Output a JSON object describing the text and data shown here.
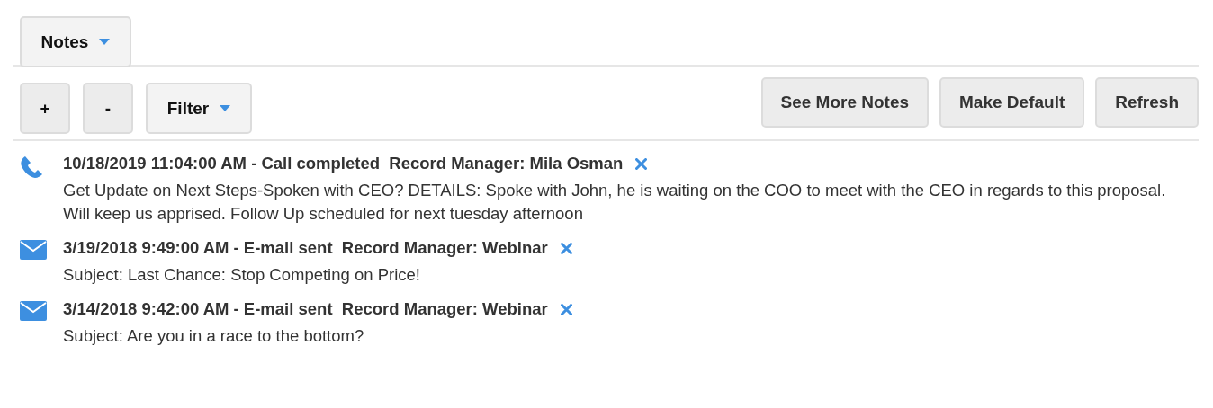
{
  "view_menu": {
    "label": "Notes"
  },
  "toolbar": {
    "add": "+",
    "remove": "-",
    "filter": "Filter",
    "actions": [
      "See More Notes",
      "Make Default",
      "Refresh"
    ]
  },
  "notes": [
    {
      "kind": "call",
      "header": "10/18/2019 11:04:00 AM - Call completed  Record Manager: Mila Osman",
      "body": "Get Update on Next Steps-Spoken with CEO? DETAILS: Spoke with John, he is waiting on the COO to meet with the CEO in regards to this proposal. Will keep us apprised. Follow Up scheduled for next tuesday afternoon"
    },
    {
      "kind": "email",
      "header": "3/19/2018 9:49:00 AM - E-mail sent  Record Manager: Webinar",
      "body": "Subject: Last Chance: Stop Competing on Price!"
    },
    {
      "kind": "email",
      "header": "3/14/2018 9:42:00 AM - E-mail sent  Record Manager: Webinar",
      "body": "Subject: Are you in a race to the bottom?"
    }
  ]
}
